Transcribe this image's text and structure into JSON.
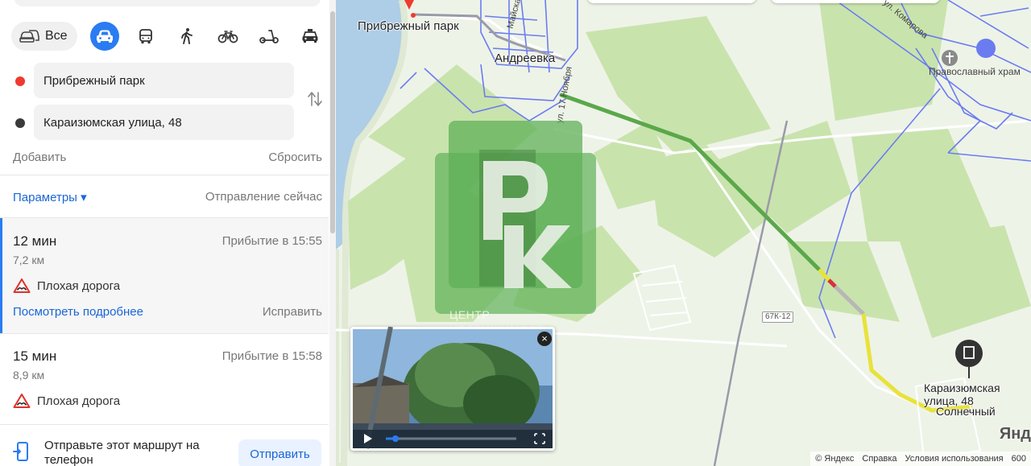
{
  "modes": {
    "all_label": "Все",
    "items": [
      "car",
      "bus",
      "walk",
      "bike",
      "scooter",
      "taxi"
    ]
  },
  "route_points": {
    "from": "Прибрежный парк",
    "to": "Караизюмская улица, 48",
    "from_color": "#f03a2f",
    "to_color": "#3a3a3a"
  },
  "actions": {
    "add": "Добавить",
    "reset": "Сбросить"
  },
  "params": {
    "label": "Параметры ▾",
    "departure": "Отправление сейчас"
  },
  "routes": [
    {
      "time": "12 мин",
      "arrival": "Прибытие в 15:55",
      "distance": "7,2 км",
      "warning": "Плохая дорога",
      "details": "Посмотреть подробнее",
      "fix": "Исправить"
    },
    {
      "time": "15 мин",
      "arrival": "Прибытие в 15:58",
      "distance": "8,9 км",
      "warning": "Плохая дорога"
    }
  ],
  "send": {
    "text": "Отправьте этот маршрут на телефон",
    "button": "Отправить"
  },
  "map": {
    "labels": {
      "start": "Прибрежный парк",
      "village": "Андреевка",
      "church": "Православный храм",
      "destination": "Караизюмская улица, 48",
      "solnechny": "Солнечный",
      "street_komarova": "ул. Комарова",
      "street_noyabrya": "ул. 17 Ноября",
      "street_maiskaya": "Майская",
      "road": "67К-12"
    },
    "watermark": "ЦЕНТР НЕДВИЖИМОСТИ",
    "footer": [
      "© Яндекс",
      "Справка",
      "Условия использования"
    ],
    "scale": "600",
    "logo": "Янд"
  },
  "colors": {
    "accent": "#2a7cf2",
    "route_green": "#5aa84a",
    "route_yellow": "#e8e23a",
    "route_red": "#d9303a"
  }
}
